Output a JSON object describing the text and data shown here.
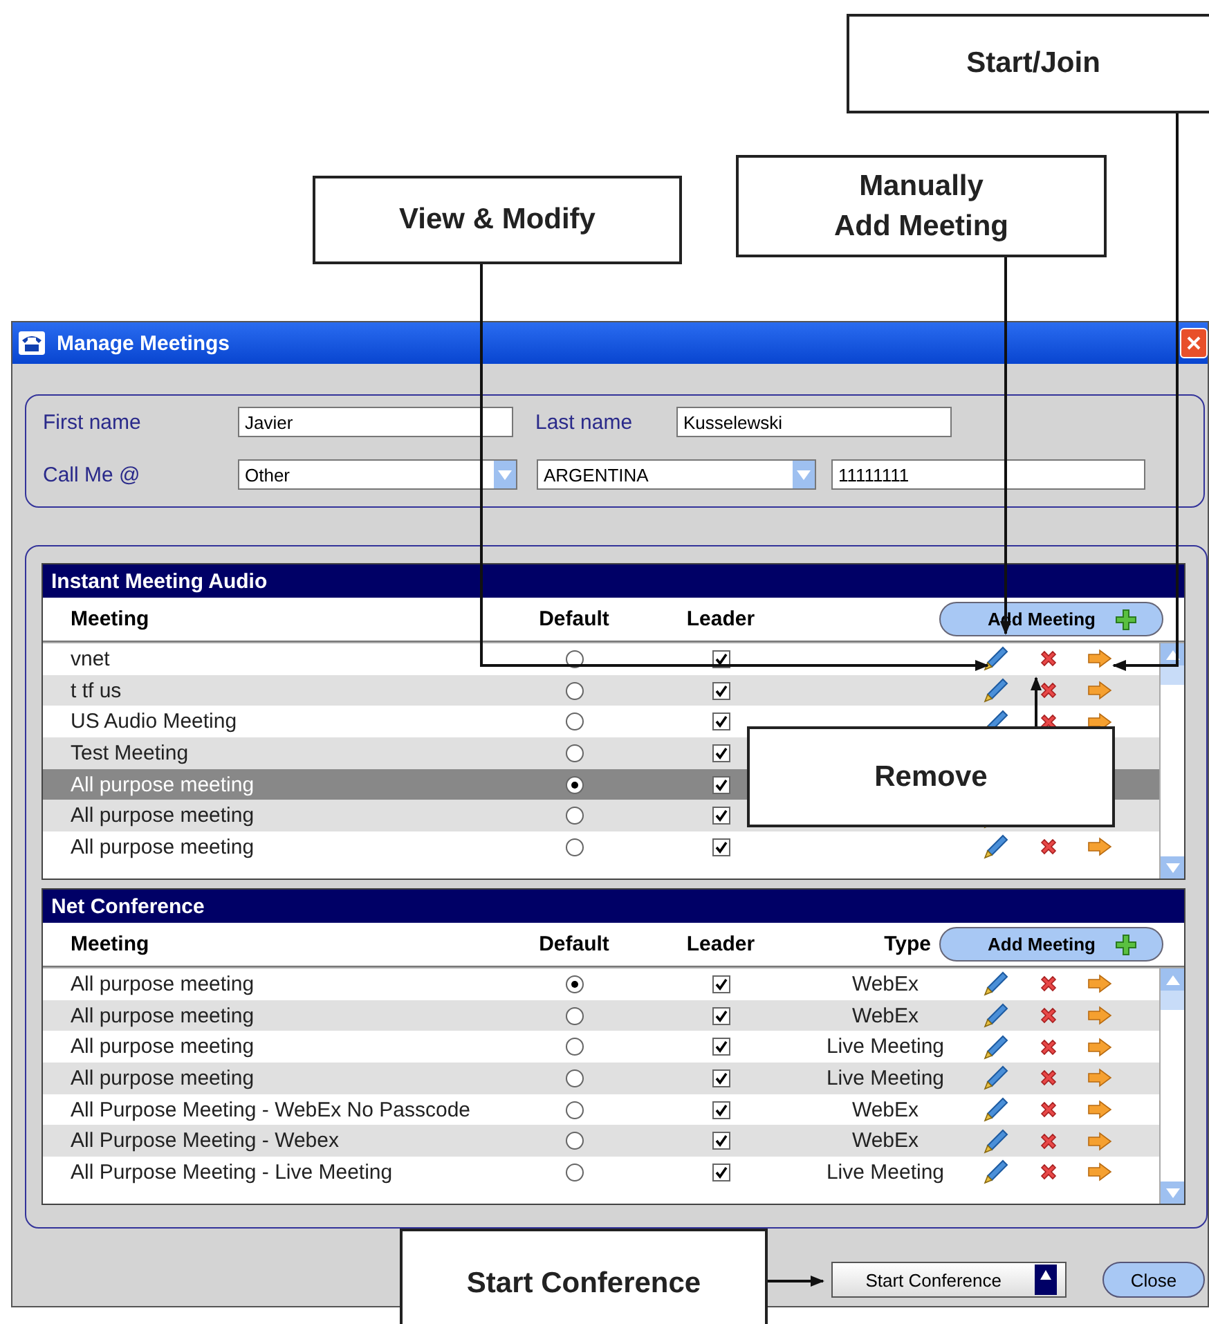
{
  "window": {
    "title": "Manage Meetings"
  },
  "form": {
    "first_name_label": "First name",
    "first_name": "Javier",
    "last_name_label": "Last name",
    "last_name": "Kusselewski",
    "call_me_label": "Call Me @",
    "call_me": "Other",
    "country": "ARGENTINA",
    "phone": "11111111"
  },
  "sections": [
    {
      "title": "Instant Meeting Audio",
      "columns": [
        "Meeting",
        "Default",
        "Leader"
      ],
      "add_button": "Add Meeting",
      "rows": [
        {
          "meeting": "vnet",
          "default": false,
          "leader": true,
          "selected": false
        },
        {
          "meeting": "t tf us",
          "default": false,
          "leader": true,
          "selected": false
        },
        {
          "meeting": "US Audio Meeting",
          "default": false,
          "leader": true,
          "selected": false
        },
        {
          "meeting": "Test Meeting",
          "default": false,
          "leader": true,
          "selected": false
        },
        {
          "meeting": "All purpose meeting",
          "default": true,
          "leader": true,
          "selected": true
        },
        {
          "meeting": "All purpose meeting",
          "default": false,
          "leader": true,
          "selected": false
        },
        {
          "meeting": "All purpose meeting",
          "default": false,
          "leader": true,
          "selected": false
        }
      ]
    },
    {
      "title": "Net Conference",
      "columns": [
        "Meeting",
        "Default",
        "Leader",
        "Type"
      ],
      "add_button": "Add Meeting",
      "rows": [
        {
          "meeting": "All purpose meeting",
          "default": true,
          "leader": true,
          "type": "WebEx",
          "selected": false
        },
        {
          "meeting": "All purpose meeting",
          "default": false,
          "leader": true,
          "type": "WebEx",
          "selected": false
        },
        {
          "meeting": "All purpose meeting",
          "default": false,
          "leader": true,
          "type": "Live Meeting",
          "selected": false
        },
        {
          "meeting": "All purpose meeting",
          "default": false,
          "leader": true,
          "type": "Live Meeting",
          "selected": false
        },
        {
          "meeting": "All Purpose Meeting - WebEx No Passcode",
          "default": false,
          "leader": true,
          "type": "WebEx",
          "selected": false
        },
        {
          "meeting": "All Purpose Meeting - Webex",
          "default": false,
          "leader": true,
          "type": "WebEx",
          "selected": false
        },
        {
          "meeting": "All Purpose Meeting - Live Meeting",
          "default": false,
          "leader": true,
          "type": "Live Meeting",
          "selected": false
        }
      ]
    }
  ],
  "buttons": {
    "start_conference": "Start Conference",
    "close": "Close"
  },
  "callouts": [
    {
      "text": "Start/Join"
    },
    {
      "text": "View & Modify"
    },
    {
      "text": "Manually\nAdd Meeting"
    },
    {
      "text": "Remove"
    },
    {
      "text": "Start Conference"
    }
  ]
}
